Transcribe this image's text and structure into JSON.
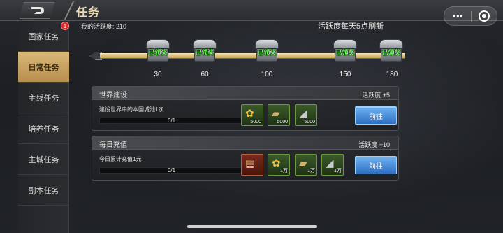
{
  "header": {
    "title": "任务"
  },
  "sidebar": {
    "items": [
      {
        "label": "国家任务",
        "active": false,
        "badge": "1"
      },
      {
        "label": "日常任务",
        "active": true
      },
      {
        "label": "主线任务",
        "active": false
      },
      {
        "label": "培养任务",
        "active": false
      },
      {
        "label": "主城任务",
        "active": false
      },
      {
        "label": "副本任务",
        "active": false
      }
    ]
  },
  "activity": {
    "my_label": "我的活跃度: 210",
    "refresh_note": "活跃度每天5点刷新",
    "milestones": [
      {
        "value": "30",
        "status": "已领奖"
      },
      {
        "value": "60",
        "status": "已领奖"
      },
      {
        "value": "100",
        "status": "已领奖"
      },
      {
        "value": "150",
        "status": "已领奖"
      },
      {
        "value": "180",
        "status": "已领奖"
      }
    ]
  },
  "tasks": [
    {
      "name": "世界建设",
      "reward_activity": "活跃度 +5",
      "description": "建设世界中的本国城池1次",
      "progress": "0/1",
      "rewards": [
        {
          "icon": "grain-icon",
          "amount": "5000"
        },
        {
          "icon": "wood-icon",
          "amount": "5000"
        },
        {
          "icon": "iron-icon",
          "amount": "5000"
        }
      ],
      "button": "前往"
    },
    {
      "name": "每日充值",
      "reward_activity": "活跃度 +10",
      "description": "今日累计充值1元",
      "progress": "0/1",
      "rewards": [
        {
          "icon": "token-card-icon",
          "amount": ""
        },
        {
          "icon": "grain-icon",
          "amount": "1万"
        },
        {
          "icon": "wood-icon",
          "amount": "1万"
        },
        {
          "icon": "iron-icon",
          "amount": "1万"
        }
      ],
      "button": "前往"
    }
  ],
  "colors": {
    "accent": "#c9a75a",
    "claimed": "#6dff5a",
    "button": "#2f6fc4"
  }
}
